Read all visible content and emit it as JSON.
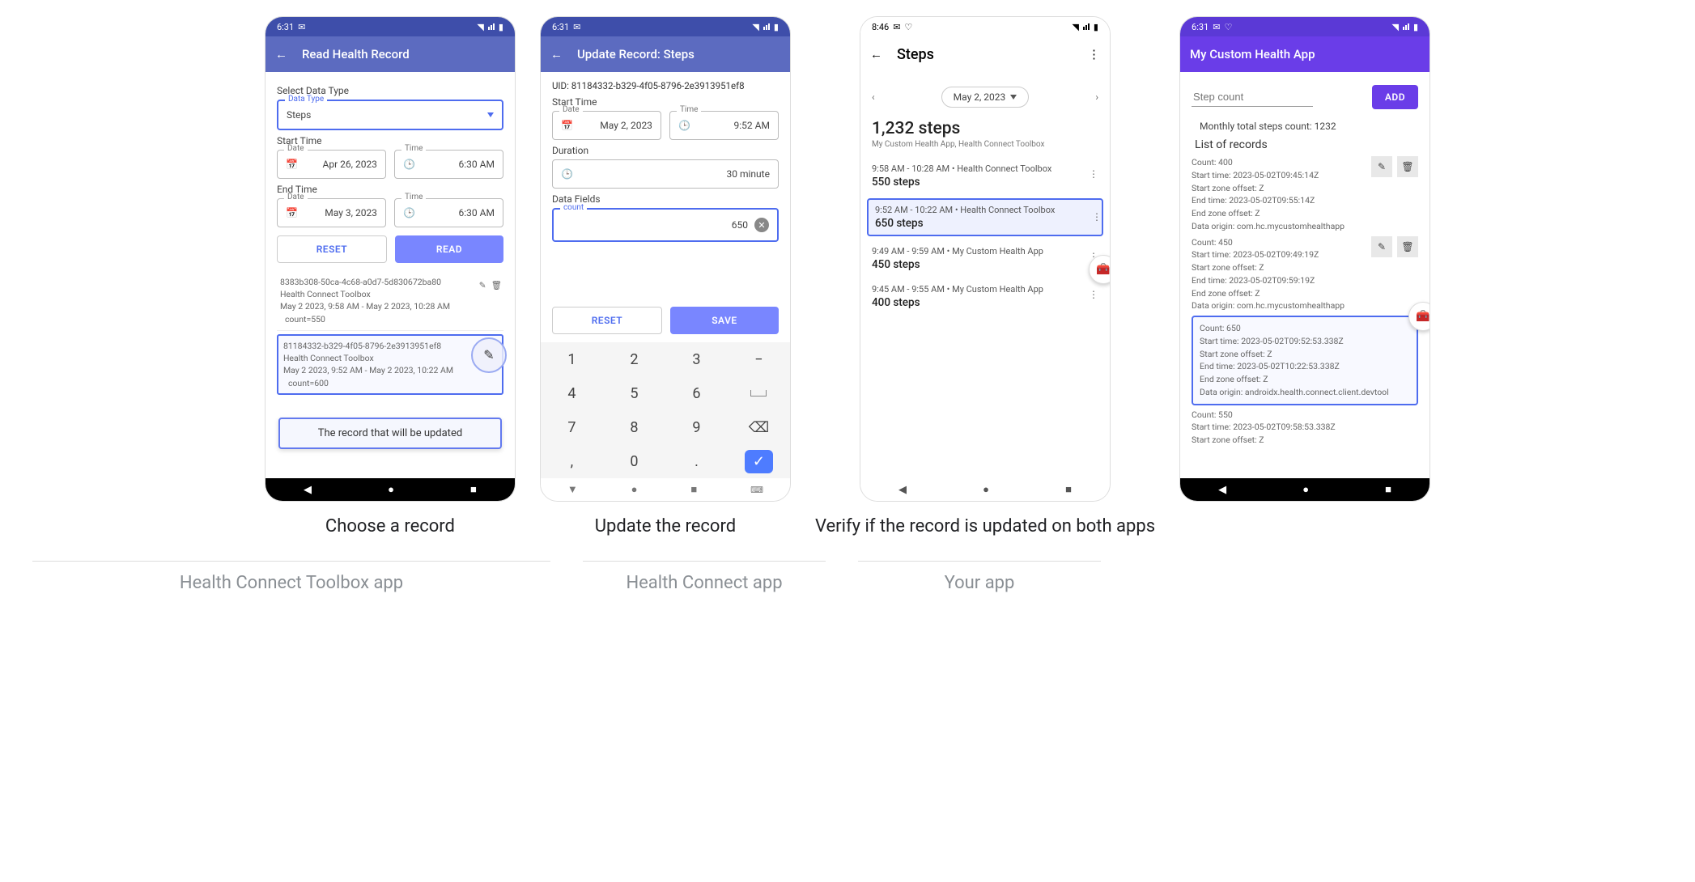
{
  "captions": {
    "c1": "Choose a record",
    "c2": "Update the record",
    "c3": "Verify if the record is updated on both apps"
  },
  "section_labels": {
    "toolbox": "Health Connect Toolbox  app",
    "hc": "Health Connect app",
    "your": "Your app"
  },
  "shared": {
    "wifi_glyph": "▾",
    "battery_glyph": "▮"
  },
  "p1": {
    "status_time": "6:31",
    "status_icon_name": "mail-icon",
    "title": "Read Health Record",
    "select_label": "Select Data Type",
    "data_type_legend": "Data Type",
    "data_type_value": "Steps",
    "start_time_label": "Start Time",
    "start_date_legend": "Date",
    "start_date_value": "Apr 26, 2023",
    "start_time_legend": "Time",
    "start_time_value": "6:30 AM",
    "end_time_label": "End Time",
    "end_date_legend": "Date",
    "end_date_value": "May 3, 2023",
    "end_time_legend": "Time",
    "end_time_value": "6:30 AM",
    "reset": "RESET",
    "read": "READ",
    "rec1": {
      "uid": "8383b308-50ca-4c68-a0d7-5d830672ba80",
      "source": "Health Connect Toolbox",
      "range": "May 2 2023, 9:58 AM - May 2 2023, 10:28 AM",
      "count": "count=550"
    },
    "rec2": {
      "uid": "81184332-b329-4f05-8796-2e3913951ef8",
      "source": "Health Connect Toolbox",
      "range": "May 2 2023, 9:52 AM - May 2 2023, 10:22 AM",
      "count": "count=600"
    },
    "callout": "The record that will be updated"
  },
  "p2": {
    "status_time": "6:31",
    "title": "Update Record: Steps",
    "uid_line": "UID: 81184332-b329-4f05-8796-2e3913951ef8",
    "start_time_label": "Start Time",
    "date_legend": "Date",
    "date_value": "May 2, 2023",
    "time_legend": "Time",
    "time_value": "9:52 AM",
    "duration_label": "Duration",
    "duration_value": "30 minute",
    "data_fields_label": "Data Fields",
    "count_legend": "count",
    "count_value": "650",
    "reset": "RESET",
    "save": "SAVE",
    "keys": [
      "1",
      "2",
      "3",
      "−",
      "4",
      "5",
      "6",
      "␣",
      "7",
      "8",
      "9",
      "⌫",
      ",",
      "0",
      ".",
      "✓"
    ]
  },
  "p3": {
    "status_time": "8:46",
    "title": "Steps",
    "date_value": "May 2, 2023",
    "total": "1,232 steps",
    "sources": "My Custom Health App, Health Connect Toolbox",
    "entries": [
      {
        "t": "9:58 AM - 10:28 AM • Health Connect Toolbox",
        "v": "550 steps",
        "sel": false
      },
      {
        "t": "9:52 AM - 10:22 AM • Health Connect Toolbox",
        "v": "650 steps",
        "sel": true
      },
      {
        "t": "9:49 AM - 9:59 AM • My Custom Health App",
        "v": "450 steps",
        "sel": false
      },
      {
        "t": "9:45 AM - 9:55 AM • My Custom Health App",
        "v": "400 steps",
        "sel": false
      }
    ]
  },
  "p4": {
    "status_time": "6:31",
    "title": "My Custom Health App",
    "input_placeholder": "Step count",
    "add": "ADD",
    "monthly": "Monthly total steps count: 1232",
    "list_header": "List of records",
    "cards": [
      {
        "sel": false,
        "lines": [
          "Count: 400",
          "Start time: 2023-05-02T09:45:14Z",
          "Start zone offset: Z",
          "End time: 2023-05-02T09:55:14Z",
          "End zone offset: Z",
          "Data origin: com.hc.mycustomhealthapp"
        ]
      },
      {
        "sel": false,
        "lines": [
          "Count: 450",
          "Start time: 2023-05-02T09:49:19Z",
          "Start zone offset: Z",
          "End time: 2023-05-02T09:59:19Z",
          "End zone offset: Z",
          "Data origin: com.hc.mycustomhealthapp"
        ]
      },
      {
        "sel": true,
        "lines": [
          "Count: 650",
          "Start time: 2023-05-02T09:52:53.338Z",
          "Start zone offset: Z",
          "End time: 2023-05-02T10:22:53.338Z",
          "End zone offset: Z",
          "Data origin: androidx.health.connect.client.devtool"
        ]
      },
      {
        "sel": false,
        "lines": [
          "Count: 550",
          "Start time: 2023-05-02T09:58:53.338Z",
          "Start zone offset: Z"
        ]
      }
    ]
  }
}
